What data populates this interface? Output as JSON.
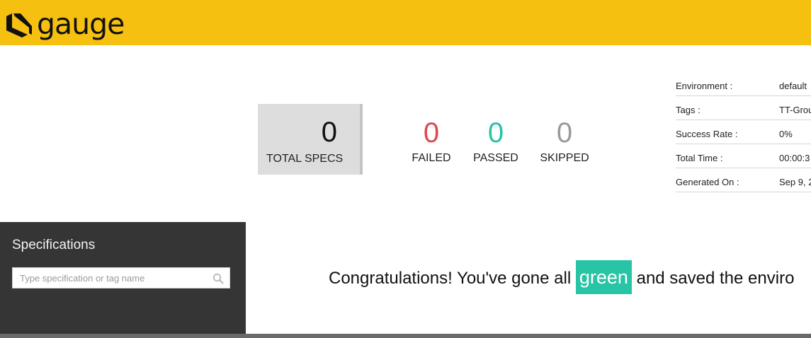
{
  "header": {
    "logo_text": "gauge",
    "icon": "gauge-logo-icon",
    "background_color": "#f5c010"
  },
  "summary": {
    "total_specs": {
      "value": "0",
      "label": "TOTAL SPECS"
    },
    "failed": {
      "value": "0",
      "label": "FAILED",
      "color": "#e0474c"
    },
    "passed": {
      "value": "0",
      "label": "PASSED",
      "color": "#27c4a5"
    },
    "skipped": {
      "value": "0",
      "label": "SKIPPED",
      "color": "#9a9a9a"
    }
  },
  "meta": [
    {
      "key": "Environment :",
      "value": "default"
    },
    {
      "key": "Tags :",
      "value": "TT-Grou"
    },
    {
      "key": "Success Rate :",
      "value": "0%"
    },
    {
      "key": "Total Time :",
      "value": "00:00:3"
    },
    {
      "key": "Generated On :",
      "value": "Sep 9, 2"
    }
  ],
  "sidebar": {
    "title": "Specifications",
    "search_placeholder": "Type specification or tag name",
    "search_value": "",
    "search_icon": "search-icon"
  },
  "message": {
    "prefix": "Congratulations! You've gone all",
    "highlight": "green",
    "suffix": "and saved the enviro",
    "highlight_color": "#27c4a5"
  }
}
